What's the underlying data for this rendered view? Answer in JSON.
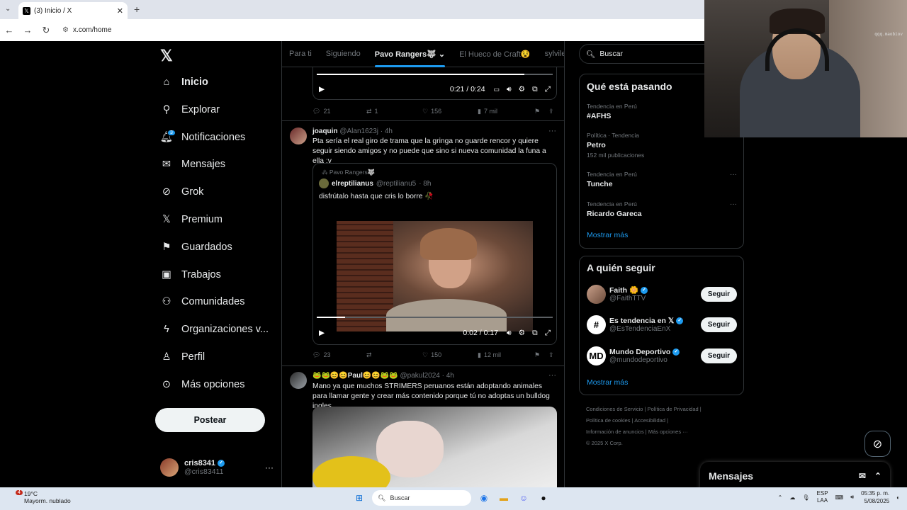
{
  "browser": {
    "tab_title": "(3) Inicio / X",
    "url": "x.com/home"
  },
  "sidebar": {
    "items": [
      {
        "label": "Inicio",
        "icon": "home-icon"
      },
      {
        "label": "Explorar",
        "icon": "search-icon"
      },
      {
        "label": "Notificaciones",
        "icon": "bell-icon",
        "badge": "3"
      },
      {
        "label": "Mensajes",
        "icon": "mail-icon"
      },
      {
        "label": "Grok",
        "icon": "grok-icon"
      },
      {
        "label": "Premium",
        "icon": "x-icon"
      },
      {
        "label": "Guardados",
        "icon": "bookmark-icon"
      },
      {
        "label": "Trabajos",
        "icon": "briefcase-icon"
      },
      {
        "label": "Comunidades",
        "icon": "people-icon"
      },
      {
        "label": "Organizaciones v...",
        "icon": "lightning-icon"
      },
      {
        "label": "Perfil",
        "icon": "person-icon"
      },
      {
        "label": "Más opciones",
        "icon": "more-circle-icon"
      }
    ],
    "post_label": "Postear",
    "account": {
      "name": "cris8341",
      "handle": "@cris83411"
    }
  },
  "timeline": {
    "tabs": [
      "Para ti",
      "Siguiendo",
      "Pavo Rangers🐺",
      "El Hueco de Craft😵",
      "sylvile"
    ],
    "tweet1": {
      "time": "0:21 / 0:24",
      "progress": 0.88,
      "stats": {
        "replies": "21",
        "reposts": "1",
        "likes": "156",
        "views": "7 mil"
      }
    },
    "tweet2": {
      "name": "joaquin",
      "handle": "@Alan1623j",
      "age": "· 4h",
      "text": "Pta sería el real giro de trama que la gringa no guarde rencor y quiere seguir siendo amigos y no puede que sino si nueva comunidad la funa a ella :v",
      "quote": {
        "community": "Pavo Rangers🐺",
        "name": "elreptilianus",
        "handle": "@reptilianu5",
        "age": "· 8h",
        "text": "disfrútalo hasta que cris lo borre 🥀"
      },
      "time": "0:02 / 0:17",
      "progress": 0.12,
      "stats": {
        "replies": "23",
        "reposts": "",
        "likes": "150",
        "views": "12 mil"
      }
    },
    "tweet3": {
      "name": "🐸🐸😊😊Paul😊😊🐸🐸",
      "handle": "@pakul2024",
      "age": "· 4h",
      "text": "Mano ya que muchos STRIMERS peruanos están adoptando animales para llamar gente y crear más contenido porque tú no adoptas un bulldog ingles"
    }
  },
  "right": {
    "search_placeholder": "Buscar",
    "trends_title": "Qué está pasando",
    "trends": [
      {
        "cat": "Tendencia en Perú",
        "name": "#AFHS",
        "count": ""
      },
      {
        "cat": "Política · Tendencia",
        "name": "Petro",
        "count": "152 mil publicaciones"
      },
      {
        "cat": "Tendencia en Perú",
        "name": "Tunche",
        "count": ""
      },
      {
        "cat": "Tendencia en Perú",
        "name": "Ricardo Gareca",
        "count": ""
      }
    ],
    "show_more": "Mostrar más",
    "follow_title": "A quién seguir",
    "follow": [
      {
        "name": "Faith 🌼",
        "handle": "@FaithTTV",
        "btn": "Seguir"
      },
      {
        "name": "Es tendencia en 𝕏",
        "handle": "@EsTendenciaEnX",
        "btn": "Seguir"
      },
      {
        "name": "Mundo Deportivo",
        "handle": "@mundodeportivo",
        "btn": "Seguir"
      }
    ],
    "show_more2": "Mostrar más",
    "footer": {
      "l1": "Condiciones de Servicio  |  Política de Privacidad  |",
      "l2": "Política de cookies  |  Accesibilidad  |",
      "l3": "Información de anuncios  |  Más opciones ···",
      "l4": "© 2025 X Corp."
    }
  },
  "messages_label": "Mensajes",
  "webcam_tag": "qqq.maobiov",
  "taskbar": {
    "weather_badge": "4",
    "temp": "19°C",
    "condition": "Mayorm. nublado",
    "search": "Buscar",
    "lang1": "ESP",
    "lang2": "LAA",
    "time": "05:35 p. m.",
    "date": "5/08/2025"
  }
}
